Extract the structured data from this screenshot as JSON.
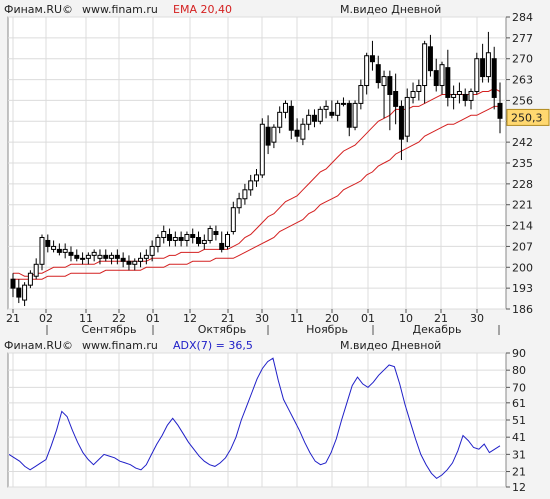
{
  "top_header": {
    "brand": "Финам.RU©",
    "site": "www.finam.ru",
    "indicator": "EMA 20,40",
    "title": "М.видео Дневной"
  },
  "bottom_header": {
    "brand": "Финам.RU©",
    "site": "www.finam.ru",
    "indicator": "ADX(7) = 36,5",
    "title": "М.видео Дневной"
  },
  "colors": {
    "candle": "#000000",
    "ema": "#d42020",
    "adx": "#2020c8",
    "label_bg": "#ffd870",
    "background": "#ffffff"
  },
  "chart_data": [
    {
      "type": "candlestick",
      "title": "М.видео Дневной",
      "indicators": [
        "EMA 20",
        "EMA 40"
      ],
      "ylim": [
        186,
        284
      ],
      "y_ticks": [
        "284",
        "277",
        "270",
        "263",
        "256",
        "249",
        "242",
        "235",
        "228",
        "221",
        "214",
        "207",
        "200",
        "193",
        "186"
      ],
      "current_value_label": "250,3",
      "current_value": 250.3,
      "x_tick_labels": [
        "21",
        "02",
        "11",
        "22",
        "01",
        "12",
        "21",
        "30",
        "11",
        "20",
        "01",
        "10",
        "21",
        "30"
      ],
      "month_labels": [
        "Сентябрь",
        "Октябрь",
        "Ноябрь",
        "Декабрь"
      ],
      "grid": true,
      "candles": [
        [
          196,
          198,
          190,
          193
        ],
        [
          193,
          196,
          188,
          190
        ],
        [
          189,
          195,
          187,
          194
        ],
        [
          194,
          199,
          193,
          198
        ],
        [
          197,
          203,
          196,
          201
        ],
        [
          201,
          211,
          199,
          210
        ],
        [
          209,
          211,
          205,
          207
        ],
        [
          206,
          209,
          205,
          207
        ],
        [
          206,
          208,
          204,
          205
        ],
        [
          205,
          208,
          203,
          206
        ],
        [
          205,
          207,
          202,
          204
        ],
        [
          204,
          206,
          202,
          203
        ],
        [
          203,
          205,
          201,
          203
        ],
        [
          203,
          205,
          201,
          204
        ],
        [
          204,
          206,
          202,
          205
        ],
        [
          203,
          206,
          201,
          204
        ],
        [
          204,
          206,
          202,
          203
        ],
        [
          203,
          205,
          201,
          204
        ],
        [
          204,
          206,
          201,
          203
        ],
        [
          203,
          205,
          200,
          202
        ],
        [
          202,
          204,
          199,
          201
        ],
        [
          201,
          203,
          199,
          202
        ],
        [
          202,
          205,
          200,
          203
        ],
        [
          203,
          206,
          201,
          204
        ],
        [
          204,
          209,
          202,
          207
        ],
        [
          207,
          211,
          205,
          210
        ],
        [
          210,
          214,
          208,
          212
        ],
        [
          211,
          213,
          207,
          209
        ],
        [
          209,
          212,
          207,
          210
        ],
        [
          210,
          212,
          207,
          209
        ],
        [
          209,
          212,
          207,
          211
        ],
        [
          211,
          213,
          208,
          210
        ],
        [
          210,
          212,
          207,
          208
        ],
        [
          208,
          211,
          206,
          209
        ],
        [
          209,
          214,
          208,
          213
        ],
        [
          212,
          214,
          209,
          211
        ],
        [
          208,
          212,
          205,
          206
        ],
        [
          207,
          212,
          206,
          211
        ],
        [
          212,
          222,
          211,
          220
        ],
        [
          220,
          225,
          218,
          223
        ],
        [
          223,
          228,
          221,
          226
        ],
        [
          226,
          231,
          224,
          229
        ],
        [
          229,
          233,
          227,
          231
        ],
        [
          231,
          250,
          230,
          248
        ],
        [
          247,
          251,
          238,
          241
        ],
        [
          242,
          248,
          240,
          247
        ],
        [
          247,
          254,
          245,
          252
        ],
        [
          252,
          256,
          250,
          255
        ],
        [
          254,
          256,
          243,
          246
        ],
        [
          246,
          250,
          242,
          244
        ],
        [
          243,
          250,
          241,
          248
        ],
        [
          248,
          253,
          246,
          251
        ],
        [
          251,
          253,
          247,
          249
        ],
        [
          249,
          254,
          248,
          253
        ],
        [
          253,
          256,
          250,
          254
        ],
        [
          252,
          256,
          250,
          251
        ],
        [
          251,
          256,
          249,
          255
        ],
        [
          255,
          257,
          254,
          255
        ],
        [
          255,
          256,
          244,
          247
        ],
        [
          247,
          256,
          246,
          255
        ],
        [
          255,
          263,
          253,
          261
        ],
        [
          261,
          272,
          258,
          271
        ],
        [
          271,
          276,
          266,
          269
        ],
        [
          268,
          271,
          260,
          262
        ],
        [
          261,
          266,
          250,
          264
        ],
        [
          264,
          266,
          246,
          258
        ],
        [
          259,
          265,
          248,
          254
        ],
        [
          254,
          256,
          236,
          243
        ],
        [
          244,
          260,
          242,
          257
        ],
        [
          257,
          262,
          255,
          259
        ],
        [
          259,
          263,
          256,
          261
        ],
        [
          261,
          276,
          255,
          275
        ],
        [
          274,
          278,
          264,
          266
        ],
        [
          266,
          270,
          259,
          261
        ],
        [
          261,
          269,
          258,
          268
        ],
        [
          267,
          273,
          254,
          257
        ],
        [
          257,
          261,
          253,
          258
        ],
        [
          258,
          262,
          255,
          259
        ],
        [
          258,
          260,
          254,
          256
        ],
        [
          256,
          260,
          253,
          259
        ],
        [
          259,
          272,
          258,
          270
        ],
        [
          270,
          275,
          262,
          264
        ],
        [
          264,
          279,
          262,
          272
        ],
        [
          270,
          274,
          253,
          257
        ],
        [
          255,
          262,
          245,
          250
        ]
      ],
      "ema20": [
        198,
        198,
        197,
        197,
        198,
        198,
        199,
        200,
        200,
        200,
        201,
        201,
        201,
        201,
        201,
        202,
        202,
        202,
        202,
        202,
        202,
        202,
        202,
        202,
        203,
        203,
        203,
        204,
        204,
        205,
        205,
        205,
        205,
        206,
        206,
        206,
        206,
        206,
        207,
        208,
        210,
        211,
        213,
        215,
        217,
        218,
        220,
        222,
        223,
        224,
        226,
        228,
        230,
        232,
        233,
        235,
        237,
        239,
        240,
        241,
        243,
        245,
        247,
        249,
        250,
        251,
        253,
        253,
        253,
        254,
        254,
        255,
        256,
        257,
        258,
        258,
        258,
        258,
        258,
        258,
        258,
        259,
        259,
        260,
        259
      ],
      "ema40": [
        196,
        196,
        196,
        196,
        196,
        196,
        197,
        197,
        197,
        197,
        198,
        198,
        198,
        198,
        198,
        198,
        199,
        199,
        199,
        199,
        199,
        199,
        199,
        200,
        200,
        200,
        200,
        201,
        201,
        201,
        201,
        202,
        202,
        202,
        202,
        203,
        203,
        203,
        203,
        204,
        205,
        206,
        207,
        208,
        209,
        210,
        212,
        213,
        214,
        215,
        216,
        218,
        219,
        221,
        222,
        223,
        224,
        226,
        227,
        228,
        229,
        231,
        232,
        234,
        235,
        236,
        238,
        239,
        240,
        241,
        242,
        244,
        245,
        246,
        247,
        248,
        248,
        249,
        250,
        251,
        251,
        252,
        253,
        254,
        254
      ]
    },
    {
      "type": "line",
      "title": "М.видео Дневной",
      "series_label": "ADX(7) = 36,5",
      "ylim": [
        12,
        90
      ],
      "y_ticks": [
        "90",
        "80",
        "70",
        "61",
        "51",
        "41",
        "31",
        "21",
        "12"
      ],
      "current_value": 36.5,
      "grid": true,
      "values": [
        31,
        29,
        27,
        24,
        22,
        24,
        26,
        28,
        36,
        45,
        56,
        53,
        45,
        38,
        32,
        28,
        25,
        28,
        31,
        30,
        29,
        27,
        26,
        25,
        23,
        22,
        25,
        31,
        37,
        42,
        48,
        52,
        48,
        43,
        38,
        34,
        30,
        27,
        25,
        24,
        26,
        29,
        34,
        41,
        51,
        59,
        67,
        75,
        81,
        85,
        87,
        74,
        63,
        57,
        51,
        45,
        38,
        32,
        27,
        25,
        26,
        32,
        40,
        51,
        61,
        71,
        76,
        72,
        70,
        73,
        77,
        80,
        83,
        82,
        72,
        60,
        50,
        40,
        31,
        25,
        20,
        17,
        19,
        22,
        26,
        33,
        42,
        39,
        35,
        34,
        37,
        32,
        34,
        36
      ]
    }
  ]
}
